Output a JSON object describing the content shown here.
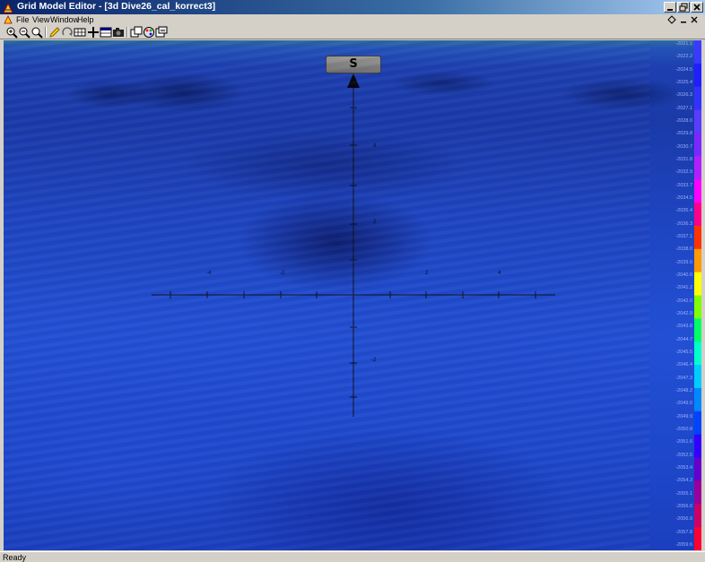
{
  "window": {
    "title": "Grid Model Editor - [3d Dive26_cal_korrect3]",
    "buttons": {
      "minimize": "0",
      "maximize": "1",
      "close": "r"
    }
  },
  "menubar": {
    "items": [
      {
        "label": "File"
      },
      {
        "label": "View"
      },
      {
        "label": "Window"
      },
      {
        "label": "Help"
      }
    ],
    "mdi_buttons": {
      "minimize": "_",
      "restore": "▫",
      "close": "×"
    }
  },
  "toolbar": {
    "tools": [
      {
        "icon": "zoom-in-icon"
      },
      {
        "icon": "zoom-out-icon"
      },
      {
        "icon": "zoom-fit-icon"
      },
      {
        "icon": "pencil-icon"
      },
      {
        "icon": "rotate-icon"
      },
      {
        "icon": "grid-icon"
      },
      {
        "icon": "crosshair-icon"
      },
      {
        "icon": "table-icon"
      },
      {
        "icon": "camera-icon"
      },
      {
        "icon": "copy-window-icon"
      },
      {
        "icon": "color-palette-icon"
      },
      {
        "icon": "export-icon"
      }
    ]
  },
  "viewport": {
    "compass_label": "S",
    "axis_tick_labels": {
      "horizontal": [
        "-4",
        "-2",
        "2",
        "4"
      ],
      "vertical": [
        "4",
        "2",
        "-2"
      ]
    }
  },
  "color_scale": {
    "colors": [
      "#3a3aff",
      "#1e1eff",
      "#3232ff",
      "#5a3cff",
      "#7a28ff",
      "#b020ff",
      "#ff00ff",
      "#ff0088",
      "#ff3300",
      "#ff9900",
      "#ffff00",
      "#80ff00",
      "#00ff66",
      "#00ffcc",
      "#00ccff",
      "#0088ff",
      "#0044ff",
      "#3300ff",
      "#6600cc",
      "#990099",
      "#cc0066",
      "#ff0033"
    ],
    "labels": [
      "-2021.1",
      "-2022.2",
      "-2024.5",
      "-2025.4",
      "-2026.3",
      "-2027.1",
      "-2028.0",
      "-2029.8",
      "-2030.7",
      "-2031.8",
      "-2032.9",
      "-2033.7",
      "-2034.5",
      "-2035.4",
      "-2036.3",
      "-2037.1",
      "-2038.0",
      "-2039.0",
      "-2040.0",
      "-2041.2",
      "-2042.0",
      "-2042.9",
      "-2043.8",
      "-2044.7",
      "-2045.5",
      "-2046.4",
      "-2047.3",
      "-2048.2",
      "-2049.0",
      "-2049.9",
      "-2050.8",
      "-2051.6",
      "-2052.5",
      "-2053.4",
      "-2054.3",
      "-2055.1",
      "-2056.0",
      "-2056.9",
      "-2057.8",
      "-2059.6"
    ]
  },
  "statusbar": {
    "text": "Ready"
  }
}
